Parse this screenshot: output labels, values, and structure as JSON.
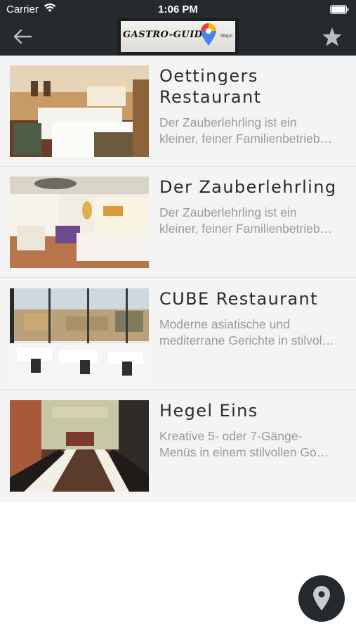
{
  "status_bar": {
    "carrier": "Carrier",
    "time": "1:06 PM"
  },
  "nav": {
    "logo_text": "GASTRO-GUIDE",
    "logo_sub": "Maps",
    "back_icon": "arrow-left-icon",
    "favorites_icon": "star-icon"
  },
  "restaurants": [
    {
      "name_lines": [
        "Oettingers",
        "Restaurant"
      ],
      "description_lines": [
        "Der Zauberlehrling ist ein",
        "kleiner, feiner Familienbetrieb…"
      ],
      "image": "dining-room-wood-panelled"
    },
    {
      "name_lines": [
        "Der Zauberlehrling"
      ],
      "description_lines": [
        "Der Zauberlehrling ist ein",
        "kleiner, feiner Familienbetrieb…"
      ],
      "image": "dining-room-bright-modern"
    },
    {
      "name_lines": [
        "CUBE Restaurant"
      ],
      "description_lines": [
        "Moderne asiatische und",
        "mediterrane Gerichte in stilvol…"
      ],
      "image": "dining-room-city-view"
    },
    {
      "name_lines": [
        "Hegel Eins"
      ],
      "description_lines": [
        "Kreative 5- oder 7-Gänge-",
        "Menüs in einem stilvollen Go…"
      ],
      "image": "dining-room-long-tables"
    }
  ],
  "fab": {
    "icon": "map-pin-icon"
  },
  "colors": {
    "header": "#242a2e",
    "list_background": "#f4f4f4",
    "title": "#2b2b2b",
    "description": "#9a9a9a"
  }
}
